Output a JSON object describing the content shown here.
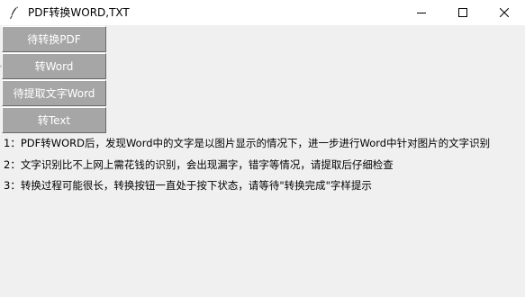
{
  "window": {
    "title": "PDF转换WORD,TXT",
    "app_icon": "feather-icon",
    "controls": [
      "minimize-icon",
      "maximize-icon",
      "close-icon"
    ]
  },
  "buttons": {
    "pending_pdf": "待转换PDF",
    "to_word": "转Word",
    "pending_extract_word": "待提取文字Word",
    "to_text": "转Text"
  },
  "notes": [
    "1：PDF转WORD后，发现Word中的文字是以图片显示的情况下，进一步进行Word中针对图片的文字识别",
    "2：文字识别比不上网上需花钱的识别，会出现漏字，错字等情况，请提取后仔细检查",
    "3：转换过程可能很长，转换按钮一直处于按下状态，请等待\"转换完成\"字样提示"
  ],
  "colors": {
    "titlebar": "#ffffff",
    "background": "#f0f0f0",
    "button_face": "#a6a6a6",
    "button_text": "#ffffff"
  }
}
